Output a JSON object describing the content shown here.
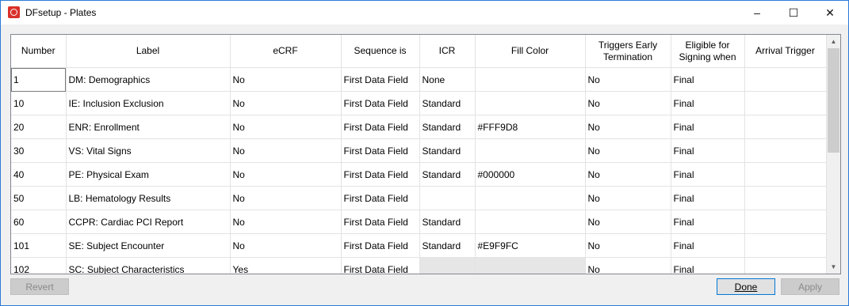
{
  "window": {
    "title": "DFsetup - Plates",
    "minimize": "–",
    "maximize": "☐",
    "close": "✕"
  },
  "table": {
    "columns": [
      "Number",
      "Label",
      "eCRF",
      "Sequence is",
      "ICR",
      "Fill Color",
      "Triggers Early Termination",
      "Eligible for Signing when",
      "Arrival Trigger"
    ],
    "rows": [
      [
        "1",
        "DM: Demographics",
        "No",
        "First Data Field",
        "None",
        "",
        "No",
        "Final",
        ""
      ],
      [
        "10",
        "IE: Inclusion Exclusion",
        "No",
        "First Data Field",
        "Standard",
        "",
        "No",
        "Final",
        ""
      ],
      [
        "20",
        "ENR: Enrollment",
        "No",
        "First Data Field",
        "Standard",
        "#FFF9D8",
        "No",
        "Final",
        ""
      ],
      [
        "30",
        "VS: Vital Signs",
        "No",
        "First Data Field",
        "Standard",
        "",
        "No",
        "Final",
        ""
      ],
      [
        "40",
        "PE: Physical Exam",
        "No",
        "First Data Field",
        "Standard",
        "#000000",
        "No",
        "Final",
        ""
      ],
      [
        "50",
        "LB: Hematology Results",
        "No",
        "First Data Field",
        "",
        "",
        "No",
        "Final",
        ""
      ],
      [
        "60",
        "CCPR: Cardiac PCI Report",
        "No",
        "First Data Field",
        "Standard",
        "",
        "No",
        "Final",
        ""
      ],
      [
        "101",
        "SE: Subject Encounter",
        "No",
        "First Data Field",
        "Standard",
        "#E9F9FC",
        "No",
        "Final",
        ""
      ],
      [
        "102",
        "SC: Subject Characteristics",
        "Yes",
        "First Data Field",
        "",
        "",
        "No",
        "Final",
        ""
      ]
    ]
  },
  "buttons": {
    "revert": "Revert",
    "done": "Done",
    "apply": "Apply"
  }
}
